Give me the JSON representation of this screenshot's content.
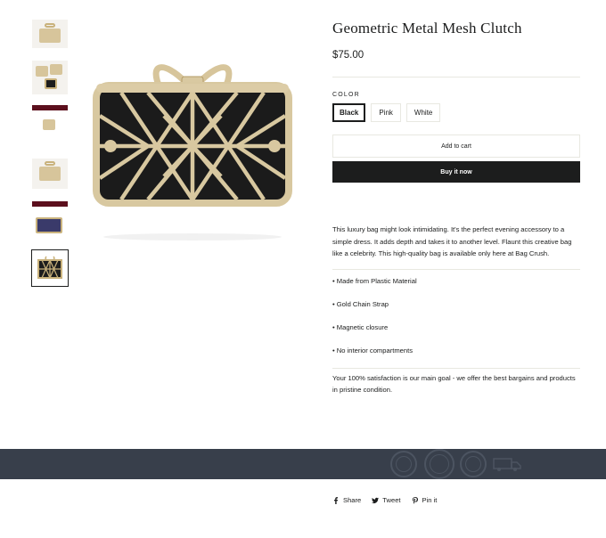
{
  "product": {
    "title": "Geometric Metal Mesh Clutch",
    "price": "$75.00",
    "color_label": "COLOR",
    "colors": [
      "Black",
      "Pink",
      "White"
    ],
    "selected_color": "Black",
    "add_to_cart": "Add to cart",
    "buy_now": "Buy it now",
    "description": "This luxury bag might look intimidating. It's the perfect evening accessory to a simple dress. It adds depth and takes it to another level. Flaunt this creative bag like a celebrity. This high-quality bag is available only here at Bag Crush.",
    "features": [
      "• Made from Plastic Material",
      "• Gold Chain Strap",
      "• Magnetic closure",
      "• No interior compartments"
    ],
    "satisfaction": "Your 100% satisfaction is our main goal - we offer the best bargains and products in pristine condition."
  },
  "share": {
    "share": "Share",
    "tweet": "Tweet",
    "pin": "Pin it"
  },
  "colors": {
    "accent": "#1c1d1d",
    "trust_bar": "#383f4b",
    "gold": "#d7c59b"
  },
  "icons": [
    "facebook-icon",
    "twitter-icon",
    "pinterest-icon",
    "lock-badge-icon",
    "truck-icon"
  ]
}
